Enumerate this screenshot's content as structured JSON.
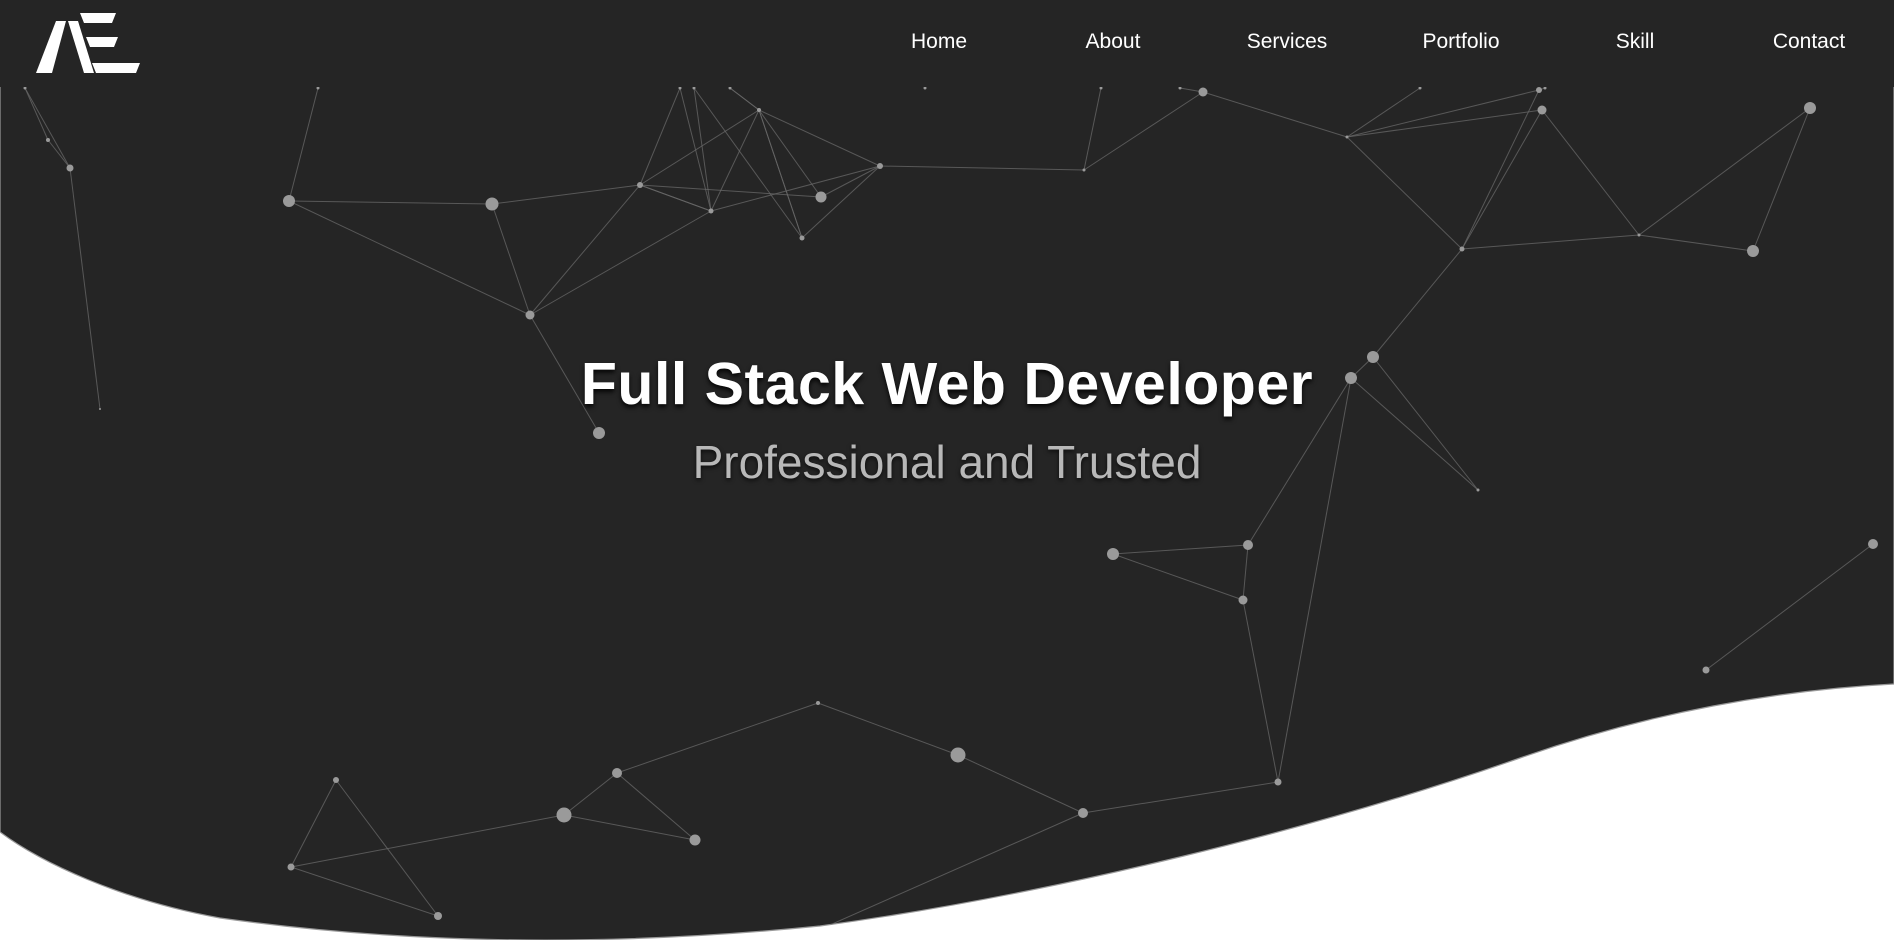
{
  "colors": {
    "hero_background": "#252525",
    "page_background": "#ffffff",
    "particle_node": "#9a9a9a",
    "particle_line": "#6a6a6a",
    "title_text": "#ffffff",
    "subtitle_text": "#b8b8b8"
  },
  "logo": {
    "text": "AE",
    "icon": "ae-logo-icon"
  },
  "nav": {
    "items": [
      {
        "label": "Home"
      },
      {
        "label": "About"
      },
      {
        "label": "Services"
      },
      {
        "label": "Portfolio"
      },
      {
        "label": "Skill"
      },
      {
        "label": "Contact"
      }
    ]
  },
  "hero": {
    "title": "Full Stack Web Developer",
    "subtitle": "Professional and Trusted"
  }
}
